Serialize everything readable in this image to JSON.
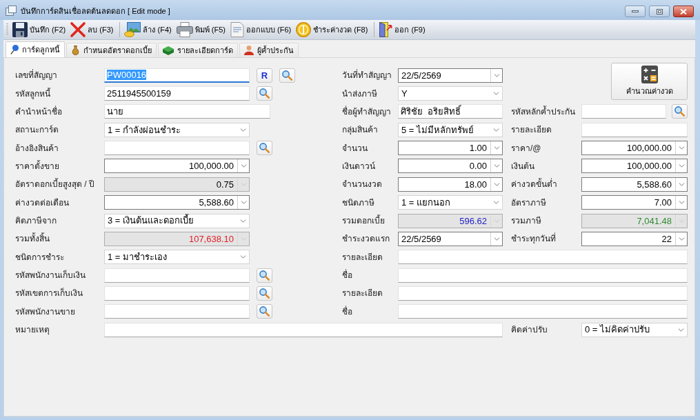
{
  "window": {
    "title": "บันทึกการ์ดสินเชื่อลดต้นลดดอก [ Edit mode ]"
  },
  "toolbar": [
    [
      {
        "kind": "save",
        "label": "บันทึก (F2)"
      },
      {
        "kind": "delete",
        "label": "ลบ (F3)"
      }
    ],
    [
      {
        "kind": "clear",
        "label": "ล้าง (F4)"
      },
      {
        "kind": "print",
        "label": "พิมพ์ (F5)"
      },
      {
        "kind": "design",
        "label": "ออกแบบ (F6)"
      },
      {
        "kind": "pay",
        "label": "ชำระค่างวด (F8)"
      }
    ],
    [
      {
        "kind": "exit",
        "label": "ออก (F9)"
      }
    ]
  ],
  "tabs": [
    {
      "kind": "pin",
      "label": "การ์ดลูกหนี้",
      "selected": true
    },
    {
      "kind": "money_bag",
      "label": "กำหนดอัตราดอกเบี้ย",
      "selected": false
    },
    {
      "kind": "book",
      "label": "รายละเอียดการ์ด",
      "selected": false
    },
    {
      "kind": "person",
      "label": "ผู้ค้ำประกัน",
      "selected": false
    }
  ],
  "calculate_button": {
    "label": "คำนวณค่างวด"
  },
  "rows": [
    {
      "left": {
        "label": "เลขที่สัญญา",
        "kind": "text",
        "value": "PW00016",
        "disabled": false,
        "focused": true,
        "buttons": [
          {
            "kind": "letter",
            "label": "R"
          },
          {
            "kind": "search"
          }
        ]
      },
      "middle": {
        "label": "วันที่ทำสัญญา",
        "kind": "date",
        "value": "22/5/2569",
        "disabled": false,
        "focused": false
      }
    },
    {
      "left": {
        "label": "รหัสลูกหนี้",
        "kind": "text",
        "value": "2511945500159",
        "disabled": false,
        "focused": false,
        "buttons": [
          {
            "kind": "search"
          }
        ]
      },
      "middle": {
        "label": "นำส่งภาษี",
        "kind": "combo",
        "value": "Y",
        "disabled": false,
        "focused": false
      }
    },
    {
      "left": {
        "label": "คำนำหน้าชื่อ",
        "kind": "text",
        "value": "นาย",
        "disabled": false,
        "focused": false
      },
      "middle": {
        "label": "ชื่อผู้ทำสัญญา",
        "kind": "text",
        "value": "ศิริชัย  อริยสิทธิ์",
        "disabled": false,
        "focused": false
      },
      "right": {
        "label": "รหัสหลักค้ำประกัน",
        "kind": "text",
        "disabled": false,
        "focused": false,
        "buttons": [
          {
            "kind": "search"
          }
        ]
      }
    },
    {
      "left": {
        "label": "สถานะการ์ด",
        "kind": "combo",
        "value": "1 = กำลังผ่อนชำระ",
        "disabled": false,
        "focused": false
      },
      "middle": {
        "label": "กลุ่มสินค้า",
        "kind": "combo",
        "value": "5 = ไม่มีหลักทรัพย์",
        "disabled": false,
        "focused": false
      },
      "right": {
        "label": "รายละเอียด",
        "kind": "text",
        "disabled": false,
        "focused": false
      }
    },
    {
      "left": {
        "label": "อ้างอิงสินค้า",
        "kind": "text",
        "disabled": false,
        "focused": false,
        "buttons": [
          {
            "kind": "search"
          }
        ]
      },
      "middle": {
        "label": "จำนวน",
        "kind": "spin",
        "value": "1.00",
        "disabled": false,
        "focused": false
      },
      "right": {
        "label": "ราคา/@",
        "kind": "spin",
        "value": "100,000.00",
        "disabled": false,
        "focused": false
      }
    },
    {
      "left": {
        "label": "ราคาตั้งขาย",
        "kind": "spin",
        "value": "100,000.00",
        "disabled": false,
        "focused": false
      },
      "middle": {
        "label": "เงินดาวน์",
        "kind": "spin",
        "value": "0.00",
        "disabled": false,
        "focused": false
      },
      "right": {
        "label": "เงินต้น",
        "kind": "spin",
        "value": "100,000.00",
        "disabled": false,
        "focused": false
      }
    },
    {
      "left": {
        "label": "อัตราดอกเบี้ยสูงสุด / ปี",
        "kind": "spin",
        "value": "0.75",
        "disabled": true,
        "focused": false
      },
      "middle": {
        "label": "จำนวนงวด",
        "kind": "spin",
        "value": "18.00",
        "disabled": false,
        "focused": false
      },
      "right": {
        "label": "ค่างวดขั้นต่ำ",
        "kind": "spin",
        "value": "5,588.60",
        "disabled": false,
        "focused": false
      }
    },
    {
      "left": {
        "label": "ค่างวดต่อเดือน",
        "kind": "spin",
        "value": "5,588.60",
        "disabled": false,
        "focused": false
      },
      "middle": {
        "label": "ชนิดภาษี",
        "kind": "combo",
        "value": "1 = แยกนอก",
        "disabled": false,
        "focused": false
      },
      "right": {
        "label": "อัตราภาษี",
        "kind": "spin",
        "value": "7.00",
        "disabled": false,
        "focused": false
      }
    },
    {
      "left": {
        "label": "คิดภาษีจาก",
        "kind": "combo",
        "value": "3 = เงินต้นและดอกเบี้ย",
        "disabled": false,
        "focused": false
      },
      "middle": {
        "label": "รวมดอกเบี้ย",
        "kind": "spin",
        "value": "596.62",
        "disabled": true,
        "focused": false,
        "color": "#2020c8"
      },
      "right": {
        "label": "รวมภาษี",
        "kind": "spin",
        "value": "7,041.48",
        "disabled": true,
        "focused": false,
        "color": "#2e8a2e"
      }
    },
    {
      "left": {
        "label": "รวมทั้งสิ้น",
        "kind": "spin",
        "value": "107,638.10",
        "disabled": true,
        "focused": false,
        "color": "#e0202a"
      },
      "middle": {
        "label": "ชำระงวดแรก",
        "kind": "date",
        "value": "22/5/2569",
        "disabled": false,
        "focused": false
      },
      "right": {
        "label": "ชำระทุกวันที่",
        "kind": "spin",
        "value": "22",
        "disabled": false,
        "focused": false
      }
    },
    {
      "left": {
        "label": "ชนิดการชำระ",
        "kind": "combo",
        "value": "1 = มาชำระเอง",
        "disabled": false,
        "focused": false
      },
      "middle": {
        "label": "รายละเอียด",
        "kind": "wide",
        "disabled": false,
        "focused": false
      }
    },
    {
      "left": {
        "label": "รหัสพนักงานเก็บเงิน",
        "kind": "text",
        "disabled": false,
        "focused": false,
        "buttons": [
          {
            "kind": "search"
          }
        ]
      },
      "middle": {
        "label": "ชื่อ",
        "kind": "wide",
        "disabled": false,
        "focused": false
      }
    },
    {
      "left": {
        "label": "รหัสเขตการเก็บเงิน",
        "kind": "text",
        "disabled": false,
        "focused": false,
        "buttons": [
          {
            "kind": "search"
          }
        ]
      },
      "middle": {
        "label": "รายละเอียด",
        "kind": "wide",
        "disabled": false,
        "focused": false
      }
    },
    {
      "left": {
        "label": "รหัสพนักงานขาย",
        "kind": "text",
        "disabled": false,
        "focused": false,
        "buttons": [
          {
            "kind": "search"
          }
        ]
      },
      "middle": {
        "label": "ชื่อ",
        "kind": "wide",
        "disabled": false,
        "focused": false
      }
    },
    {
      "left": {
        "label": "หมายเหตุ",
        "kind": "note",
        "disabled": false,
        "focused": false
      },
      "right": {
        "label": "คิดค่าปรับ",
        "kind": "combo",
        "value": "0 = ไม่คิดค่าปรับ",
        "disabled": false,
        "focused": false
      }
    }
  ]
}
